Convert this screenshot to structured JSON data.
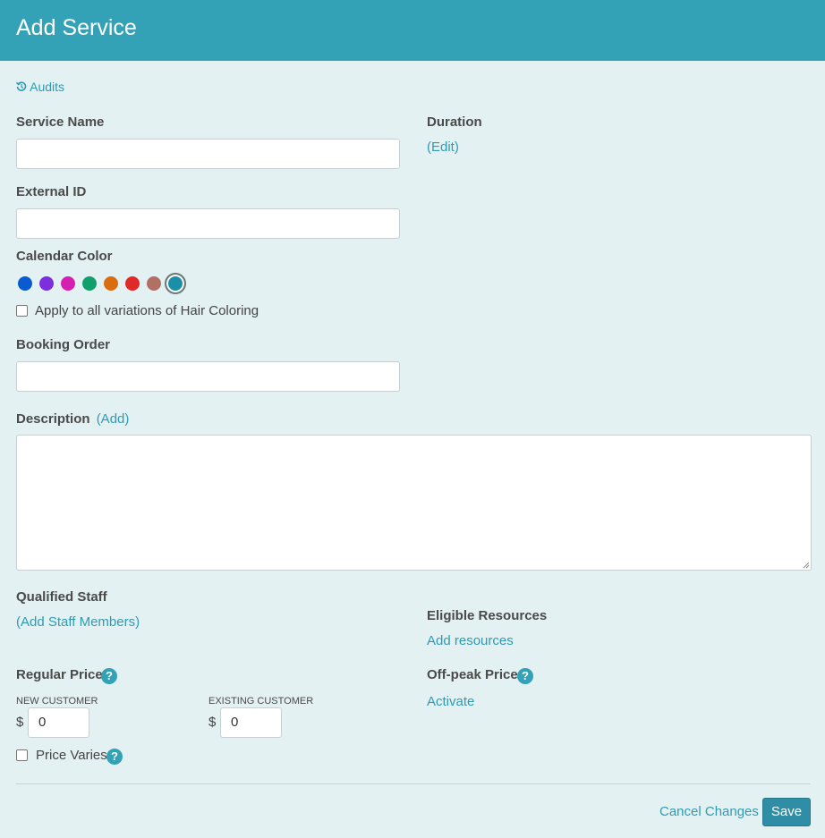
{
  "header": {
    "title": "Add Service"
  },
  "audits": {
    "label": "Audits"
  },
  "service_name": {
    "label": "Service Name",
    "value": ""
  },
  "duration": {
    "label": "Duration",
    "edit_link": "(Edit)"
  },
  "external_id": {
    "label": "External ID",
    "value": ""
  },
  "calendar_color": {
    "label": "Calendar Color",
    "colors": [
      "#0a5bcf",
      "#7c2fdd",
      "#d41fb0",
      "#11a06d",
      "#d96d0f",
      "#e02a2a",
      "#b07063",
      "#1b8fa7"
    ],
    "selected": "#1b8fa7",
    "apply_all_label": "Apply to all variations of Hair Coloring"
  },
  "booking_order": {
    "label": "Booking Order",
    "value": ""
  },
  "description": {
    "label": "Description",
    "add_link": "(Add)",
    "value": ""
  },
  "qualified_staff": {
    "label": "Qualified Staff",
    "add_link": "(Add Staff Members)"
  },
  "eligible_resources": {
    "label": "Eligible Resources",
    "add_link": "Add resources"
  },
  "regular_price": {
    "label": "Regular Price",
    "help": "?",
    "new_customer_label": "NEW CUSTOMER",
    "existing_customer_label": "EXISTING CUSTOMER",
    "currency": "$",
    "new_customer_value": "0",
    "existing_customer_value": "0",
    "price_varies_label": "Price Varies"
  },
  "offpeak_price": {
    "label": "Off-peak Price",
    "help": "?",
    "activate_link": "Activate"
  },
  "footer": {
    "cancel_label": "Cancel Changes",
    "save_label": "Save"
  }
}
